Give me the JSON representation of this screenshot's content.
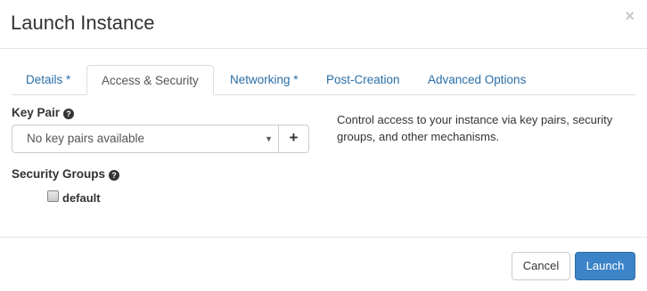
{
  "dialog": {
    "title": "Launch Instance",
    "close_symbol": "×"
  },
  "tabs": [
    {
      "label": "Details *",
      "active": false
    },
    {
      "label": "Access & Security",
      "active": true
    },
    {
      "label": "Networking *",
      "active": false
    },
    {
      "label": "Post-Creation",
      "active": false
    },
    {
      "label": "Advanced Options",
      "active": false
    }
  ],
  "key_pair": {
    "label": "Key Pair",
    "help_icon": "question-circle-icon",
    "selected_value": "No key pairs available",
    "add_symbol": "+"
  },
  "security_groups": {
    "label": "Security Groups",
    "help_icon": "question-circle-icon",
    "options": [
      {
        "label": "default",
        "checked": false
      }
    ]
  },
  "description": "Control access to your instance via key pairs, security groups, and other mechanisms.",
  "footer": {
    "cancel_label": "Cancel",
    "launch_label": "Launch"
  },
  "colors": {
    "link": "#2a6ea6",
    "primary": "#3c84c8",
    "border": "#dddddd"
  }
}
